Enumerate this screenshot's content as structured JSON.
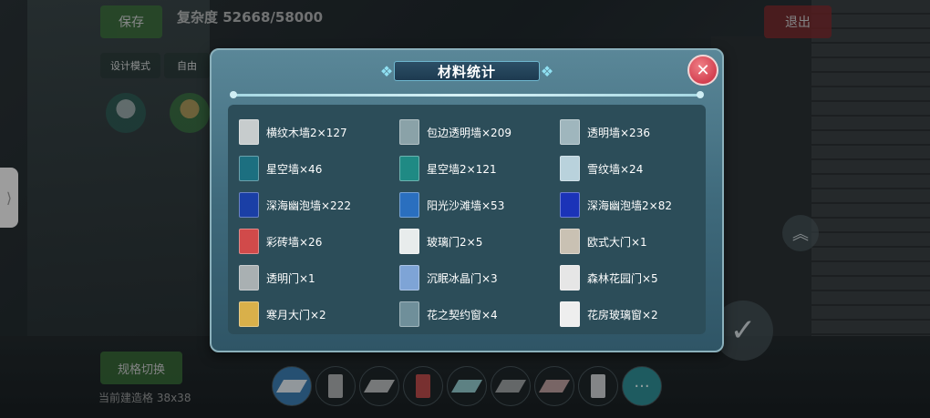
{
  "background": {
    "save_label": "保存",
    "exit_label": "退出",
    "complexity_text": "复杂度 52668/58000",
    "mode_label": "设计模式",
    "mode2_label": "自由",
    "switch_label": "规格切换",
    "grid_text": "当前建造格 38x38"
  },
  "dialog": {
    "title": "材料统计",
    "close_glyph": "✕",
    "items": [
      {
        "label": "横纹木墙2×127",
        "color": "#c7cccd"
      },
      {
        "label": "包边透明墙×209",
        "color": "#8aa2a8"
      },
      {
        "label": "透明墙×236",
        "color": "#9fb6bd"
      },
      {
        "label": "星空墙×46",
        "color": "#1c6f80"
      },
      {
        "label": "星空墙2×121",
        "color": "#1f8a84"
      },
      {
        "label": "雪纹墙×24",
        "color": "#b9d2dc"
      },
      {
        "label": "深海幽泡墙×222",
        "color": "#1a3fa6"
      },
      {
        "label": "阳光沙滩墙×53",
        "color": "#2a6fbf"
      },
      {
        "label": "深海幽泡墙2×82",
        "color": "#1b33b8"
      },
      {
        "label": "彩砖墙×26",
        "color": "#d14a4a"
      },
      {
        "label": "玻璃门2×5",
        "color": "#e8ecec"
      },
      {
        "label": "欧式大门×1",
        "color": "#c9c1b3"
      },
      {
        "label": "透明门×1",
        "color": "#a9b0b2"
      },
      {
        "label": "沉眠冰晶门×3",
        "color": "#7ea4d6"
      },
      {
        "label": "森林花园门×5",
        "color": "#e6e6e6"
      },
      {
        "label": "寒月大门×2",
        "color": "#d9b04a"
      },
      {
        "label": "花之契约窗×4",
        "color": "#6f8f9a"
      },
      {
        "label": "花房玻璃窗×2",
        "color": "#eeeeee"
      }
    ]
  },
  "toolbar": {
    "more_label": "···",
    "tools": [
      {
        "icon": "eraser-icon",
        "color": "#dfe8ee"
      },
      {
        "icon": "wall-grey-icon",
        "color": "#a9adae"
      },
      {
        "icon": "floor-grey-icon",
        "color": "#b6b9ba"
      },
      {
        "icon": "wall-red-icon",
        "color": "#b94b4b"
      },
      {
        "icon": "floor-teal-icon",
        "color": "#8fc7c9"
      },
      {
        "icon": "floor-dark-icon",
        "color": "#9a9ea0"
      },
      {
        "icon": "stairs-icon",
        "color": "#b99b9b"
      },
      {
        "icon": "wall-white-icon",
        "color": "#c9cdd0"
      }
    ]
  }
}
